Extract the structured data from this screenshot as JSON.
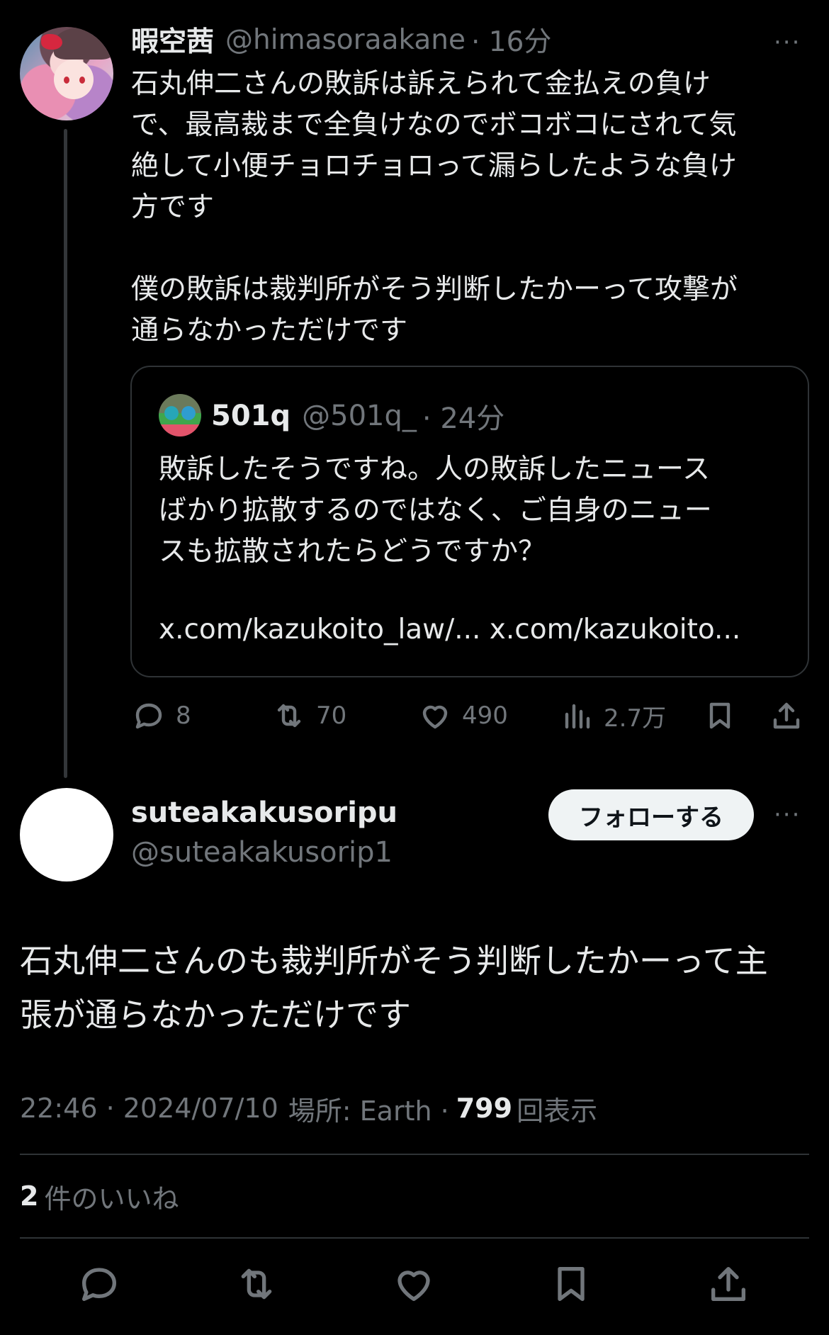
{
  "parent_tweet": {
    "display_name": "暇空茜",
    "handle": "@himasoraakane",
    "time": "· 16分",
    "more": "···",
    "text": "石丸伸二さんの敗訴は訴えられて金払えの負け\nで、最高裁まで全負けなのでボコボコにされて気\n絶して小便チョロチョロって漏らしたような負け\n方です\n\n僕の敗訴は裁判所がそう判断したかーって攻撃が\n通らなかっただけです",
    "quote": {
      "display_name": "501q",
      "handle": "@501q_",
      "time": "· 24分",
      "text": "敗訴したそうですね。人の敗訴したニュース\nばかり拡散するのではなく、ご自身のニュー\nスも拡散されたらどうですか？",
      "links": "x.com/kazukoito_law/... x.com/kazukoito..."
    },
    "actions": {
      "reply_count": "8",
      "retweet_count": "70",
      "like_count": "490",
      "view_count": "2.7万"
    }
  },
  "reply_tweet": {
    "display_name": "suteakakusoripu",
    "handle": "@suteakakusorip1",
    "follow_label": "フォローする",
    "more": "···",
    "text": "石丸伸二さんのも裁判所がそう判断したかーって主\n張が通らなかっただけです",
    "meta": {
      "time_date": "22:46 · 2024/07/10",
      "location": "場所: Earth ·",
      "views_count": "799",
      "views_label": "回表示"
    },
    "likes": {
      "count": "2",
      "label": "件のいいね"
    }
  },
  "colors": {
    "background": "#000000",
    "text": "#e7e9ea",
    "muted": "#71767b",
    "border": "#2f3336",
    "follow_button": "#eff3f4"
  },
  "icons": [
    "reply-icon",
    "retweet-icon",
    "like-icon",
    "views-icon",
    "bookmark-icon",
    "share-icon",
    "more-icon"
  ]
}
